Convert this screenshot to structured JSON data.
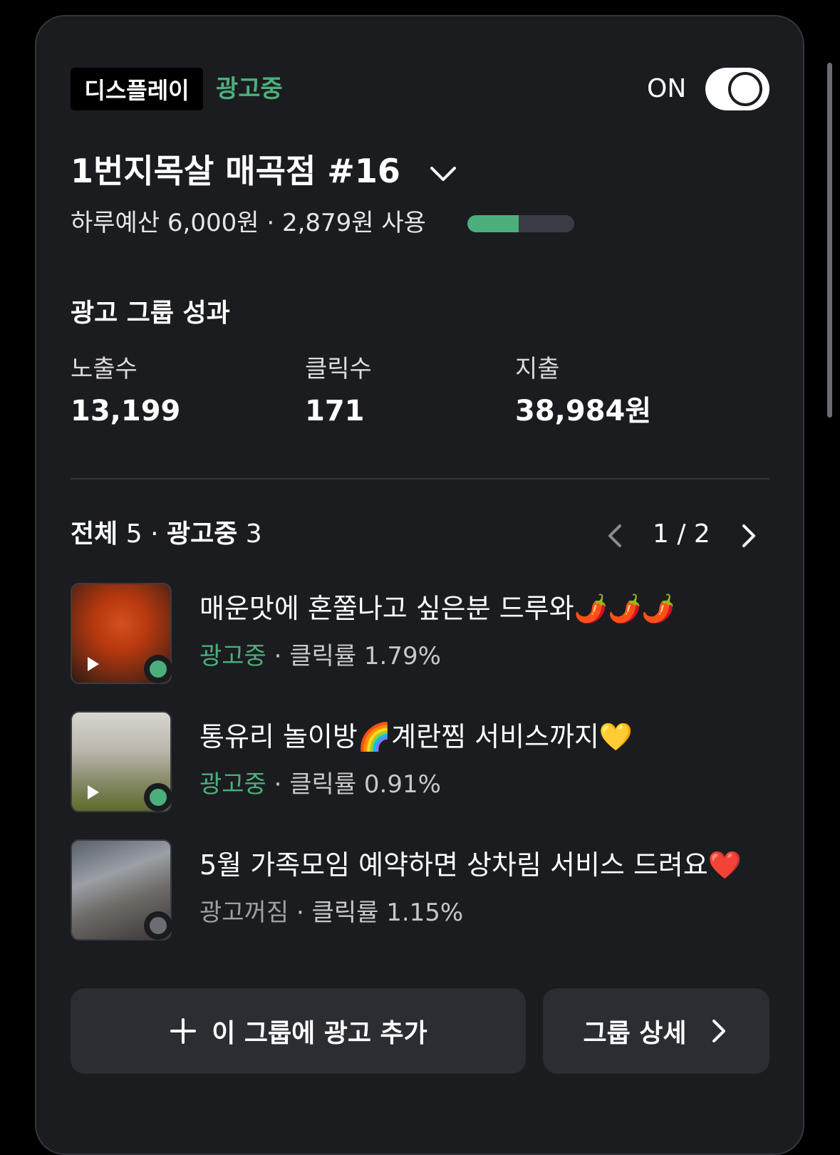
{
  "header": {
    "type_badge": "디스플레이",
    "status": "광고중",
    "toggle_label": "ON",
    "toggle_on": true
  },
  "group": {
    "title": "1번지목살 매곡점 #16",
    "budget_text": "하루예산 6,000원 · 2,879원 사용",
    "budget_used_fraction": 0.48
  },
  "performance": {
    "title": "광고 그룹 성과",
    "metrics": [
      {
        "label": "노출수",
        "value": "13,199"
      },
      {
        "label": "클릭수",
        "value": "171"
      },
      {
        "label": "지출",
        "value": "38,984원"
      }
    ]
  },
  "ads_list": {
    "total_label": "전체",
    "total_count": "5",
    "separator": "·",
    "active_label": "광고중",
    "active_count": "3",
    "page_indicator": "1 / 2"
  },
  "ads": [
    {
      "title": "매운맛에 혼쭐나고 싶은분 드루와🌶️🌶️🌶️",
      "status": "광고중",
      "status_active": true,
      "ctr_text": "· 클릭률 1.79%",
      "has_video": true
    },
    {
      "title": "통유리 놀이방🌈계란찜 서비스까지💛",
      "status": "광고중",
      "status_active": true,
      "ctr_text": "· 클릭률 0.91%",
      "has_video": true
    },
    {
      "title": "5월 가족모임 예약하면 상차림 서비스 드려요❤️",
      "status": "광고꺼짐",
      "status_active": false,
      "ctr_text": "· 클릭률 1.15%",
      "has_video": false
    }
  ],
  "buttons": {
    "add_ad": "이 그룹에 광고 추가",
    "group_detail": "그룹 상세"
  },
  "colors": {
    "accent_green": "#4caf7b",
    "status_off_dot": "#6b6d73",
    "card_bg": "#1b1c20"
  }
}
